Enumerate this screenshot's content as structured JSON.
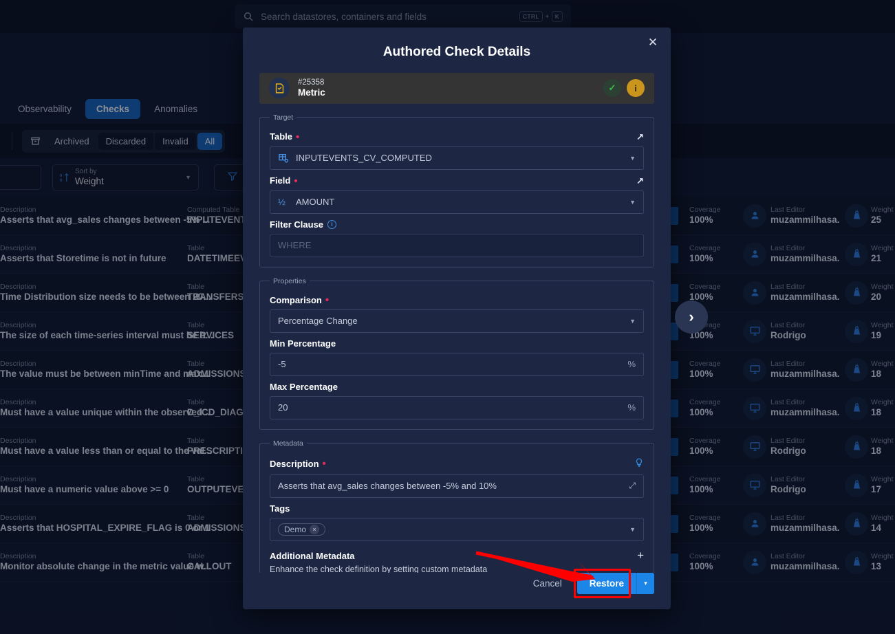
{
  "search": {
    "placeholder": "Search datastores, containers and fields",
    "kbd1": "CTRL",
    "plus": "+",
    "kbd2": "K",
    "icon": "search-icon"
  },
  "tabs": [
    {
      "label": "Observability",
      "active": false
    },
    {
      "label": "Checks",
      "active": true
    },
    {
      "label": "Anomalies",
      "active": false
    }
  ],
  "filters": {
    "archive_icon": "archive-icon",
    "items": [
      {
        "label": "Archived",
        "state": "plain"
      },
      {
        "label": "Discarded",
        "state": "dark"
      },
      {
        "label": "Invalid",
        "state": "dark"
      },
      {
        "label": "All",
        "state": "active"
      }
    ]
  },
  "controls": {
    "sort_caption": "Sort by",
    "sort_value": "Weight",
    "sort_icon": "sort-numeric-icon",
    "filter_icon": "funnel-icon",
    "caret": "▼"
  },
  "list": {
    "columns": {
      "desc": "Description",
      "computed_table": "Computed Table",
      "table": "Table",
      "coverage": "Coverage",
      "editor": "Last Editor",
      "weight": "Weight"
    },
    "rows": [
      {
        "desc": "Asserts that avg_sales changes between -5% ...",
        "table_cap": "Computed Table",
        "table": "INPUTEVENTS_",
        "coverage": "100%",
        "editor": "muzammilhasa...",
        "editor_icon": "person-icon",
        "weight": "25"
      },
      {
        "desc": "Asserts that Storetime is not in future",
        "table_cap": "Table",
        "table": "DATETIMEEVEN",
        "coverage": "100%",
        "editor": "muzammilhasa...",
        "editor_icon": "person-icon",
        "weight": "21"
      },
      {
        "desc": "Time Distribution size needs to be between 20...",
        "table_cap": "Table",
        "table": "TRANSFERS",
        "coverage": "100%",
        "editor": "muzammilhasa...",
        "editor_icon": "person-icon",
        "weight": "20"
      },
      {
        "desc": "The size of each time-series interval must be b...",
        "table_cap": "Table",
        "table": "SERVICES",
        "coverage": "100%",
        "editor": "Rodrigo",
        "editor_icon": "monitor-icon",
        "weight": "19"
      },
      {
        "desc": "The value must be between minTime and max...",
        "table_cap": "Table",
        "table": "ADMISSIONS",
        "coverage": "100%",
        "editor": "muzammilhasa...",
        "editor_icon": "monitor-icon",
        "weight": "18"
      },
      {
        "desc": "Must have a value unique within the observed ...",
        "table_cap": "Table",
        "table": "D_ICD_DIAGN",
        "coverage": "100%",
        "editor": "muzammilhasa...",
        "editor_icon": "monitor-icon",
        "weight": "18"
      },
      {
        "desc": "Must have a value less than or equal to the val...",
        "table_cap": "Table",
        "table": "PRESCRIPTION",
        "coverage": "100%",
        "editor": "Rodrigo",
        "editor_icon": "monitor-icon",
        "weight": "18"
      },
      {
        "desc": "Must have a numeric value above >= 0",
        "table_cap": "Table",
        "table": "OUTPUTEVENT",
        "coverage": "100%",
        "editor": "Rodrigo",
        "editor_icon": "monitor-icon",
        "weight": "17"
      },
      {
        "desc": "Asserts that HOSPITAL_EXPIRE_FLAG is 0 or 1",
        "table_cap": "Table",
        "table": "ADMISSIONS",
        "coverage": "100%",
        "editor": "muzammilhasa...",
        "editor_icon": "person-icon",
        "weight": "14"
      },
      {
        "desc": "Monitor absolute change in the metric value w...",
        "table_cap": "Table",
        "table": "CALLOUT",
        "coverage": "100%",
        "editor": "muzammilhasa...",
        "editor_icon": "person-icon",
        "weight": "13"
      }
    ],
    "next_arrow": "›"
  },
  "modal": {
    "title": "Authored Check Details",
    "close_icon": "close-icon",
    "id_card": {
      "icon": "check-document-icon",
      "number": "#25358",
      "type": "Metric",
      "badge_ok": "✓",
      "badge_info": "i"
    },
    "target": {
      "legend": "Target",
      "table_label": "Table",
      "table_expand_icon": "external-link-icon",
      "table_value": "INPUTEVENTS_CV_COMPUTED",
      "table_icon": "table-settings-icon",
      "field_label": "Field",
      "field_expand_icon": "external-link-icon",
      "field_value": "AMOUNT",
      "field_icon": "fraction-half-icon",
      "filter_label": "Filter Clause",
      "filter_info_icon": "info-icon",
      "filter_placeholder": "WHERE"
    },
    "properties": {
      "legend": "Properties",
      "comparison_label": "Comparison",
      "comparison_value": "Percentage Change",
      "min_label": "Min Percentage",
      "min_value": "-5",
      "min_unit": "%",
      "max_label": "Max Percentage",
      "max_value": "20",
      "max_unit": "%"
    },
    "metadata": {
      "legend": "Metadata",
      "description_label": "Description",
      "description_hint_icon": "lightbulb-icon",
      "description_value": "Asserts that avg_sales changes between -5% and 10%",
      "description_expand_icon": "expand-icon",
      "tags_label": "Tags",
      "tag_chips": [
        {
          "label": "Demo",
          "remove": "×"
        }
      ],
      "additional_title": "Additional Metadata",
      "additional_plus": "+",
      "additional_sub": "Enhance the check definition by setting custom metadata"
    },
    "footer": {
      "cancel_label": "Cancel",
      "restore_label": "Restore",
      "restore_caret": "▾"
    }
  },
  "colors": {
    "accent_blue": "#1b86e8",
    "tab_blue": "#1565c0",
    "required_red": "#e8295a",
    "highlight_red": "#fe0000",
    "ok_green": "#3cbb4e",
    "info_amber": "#c9951c",
    "modal_bg": "#1d2743"
  }
}
